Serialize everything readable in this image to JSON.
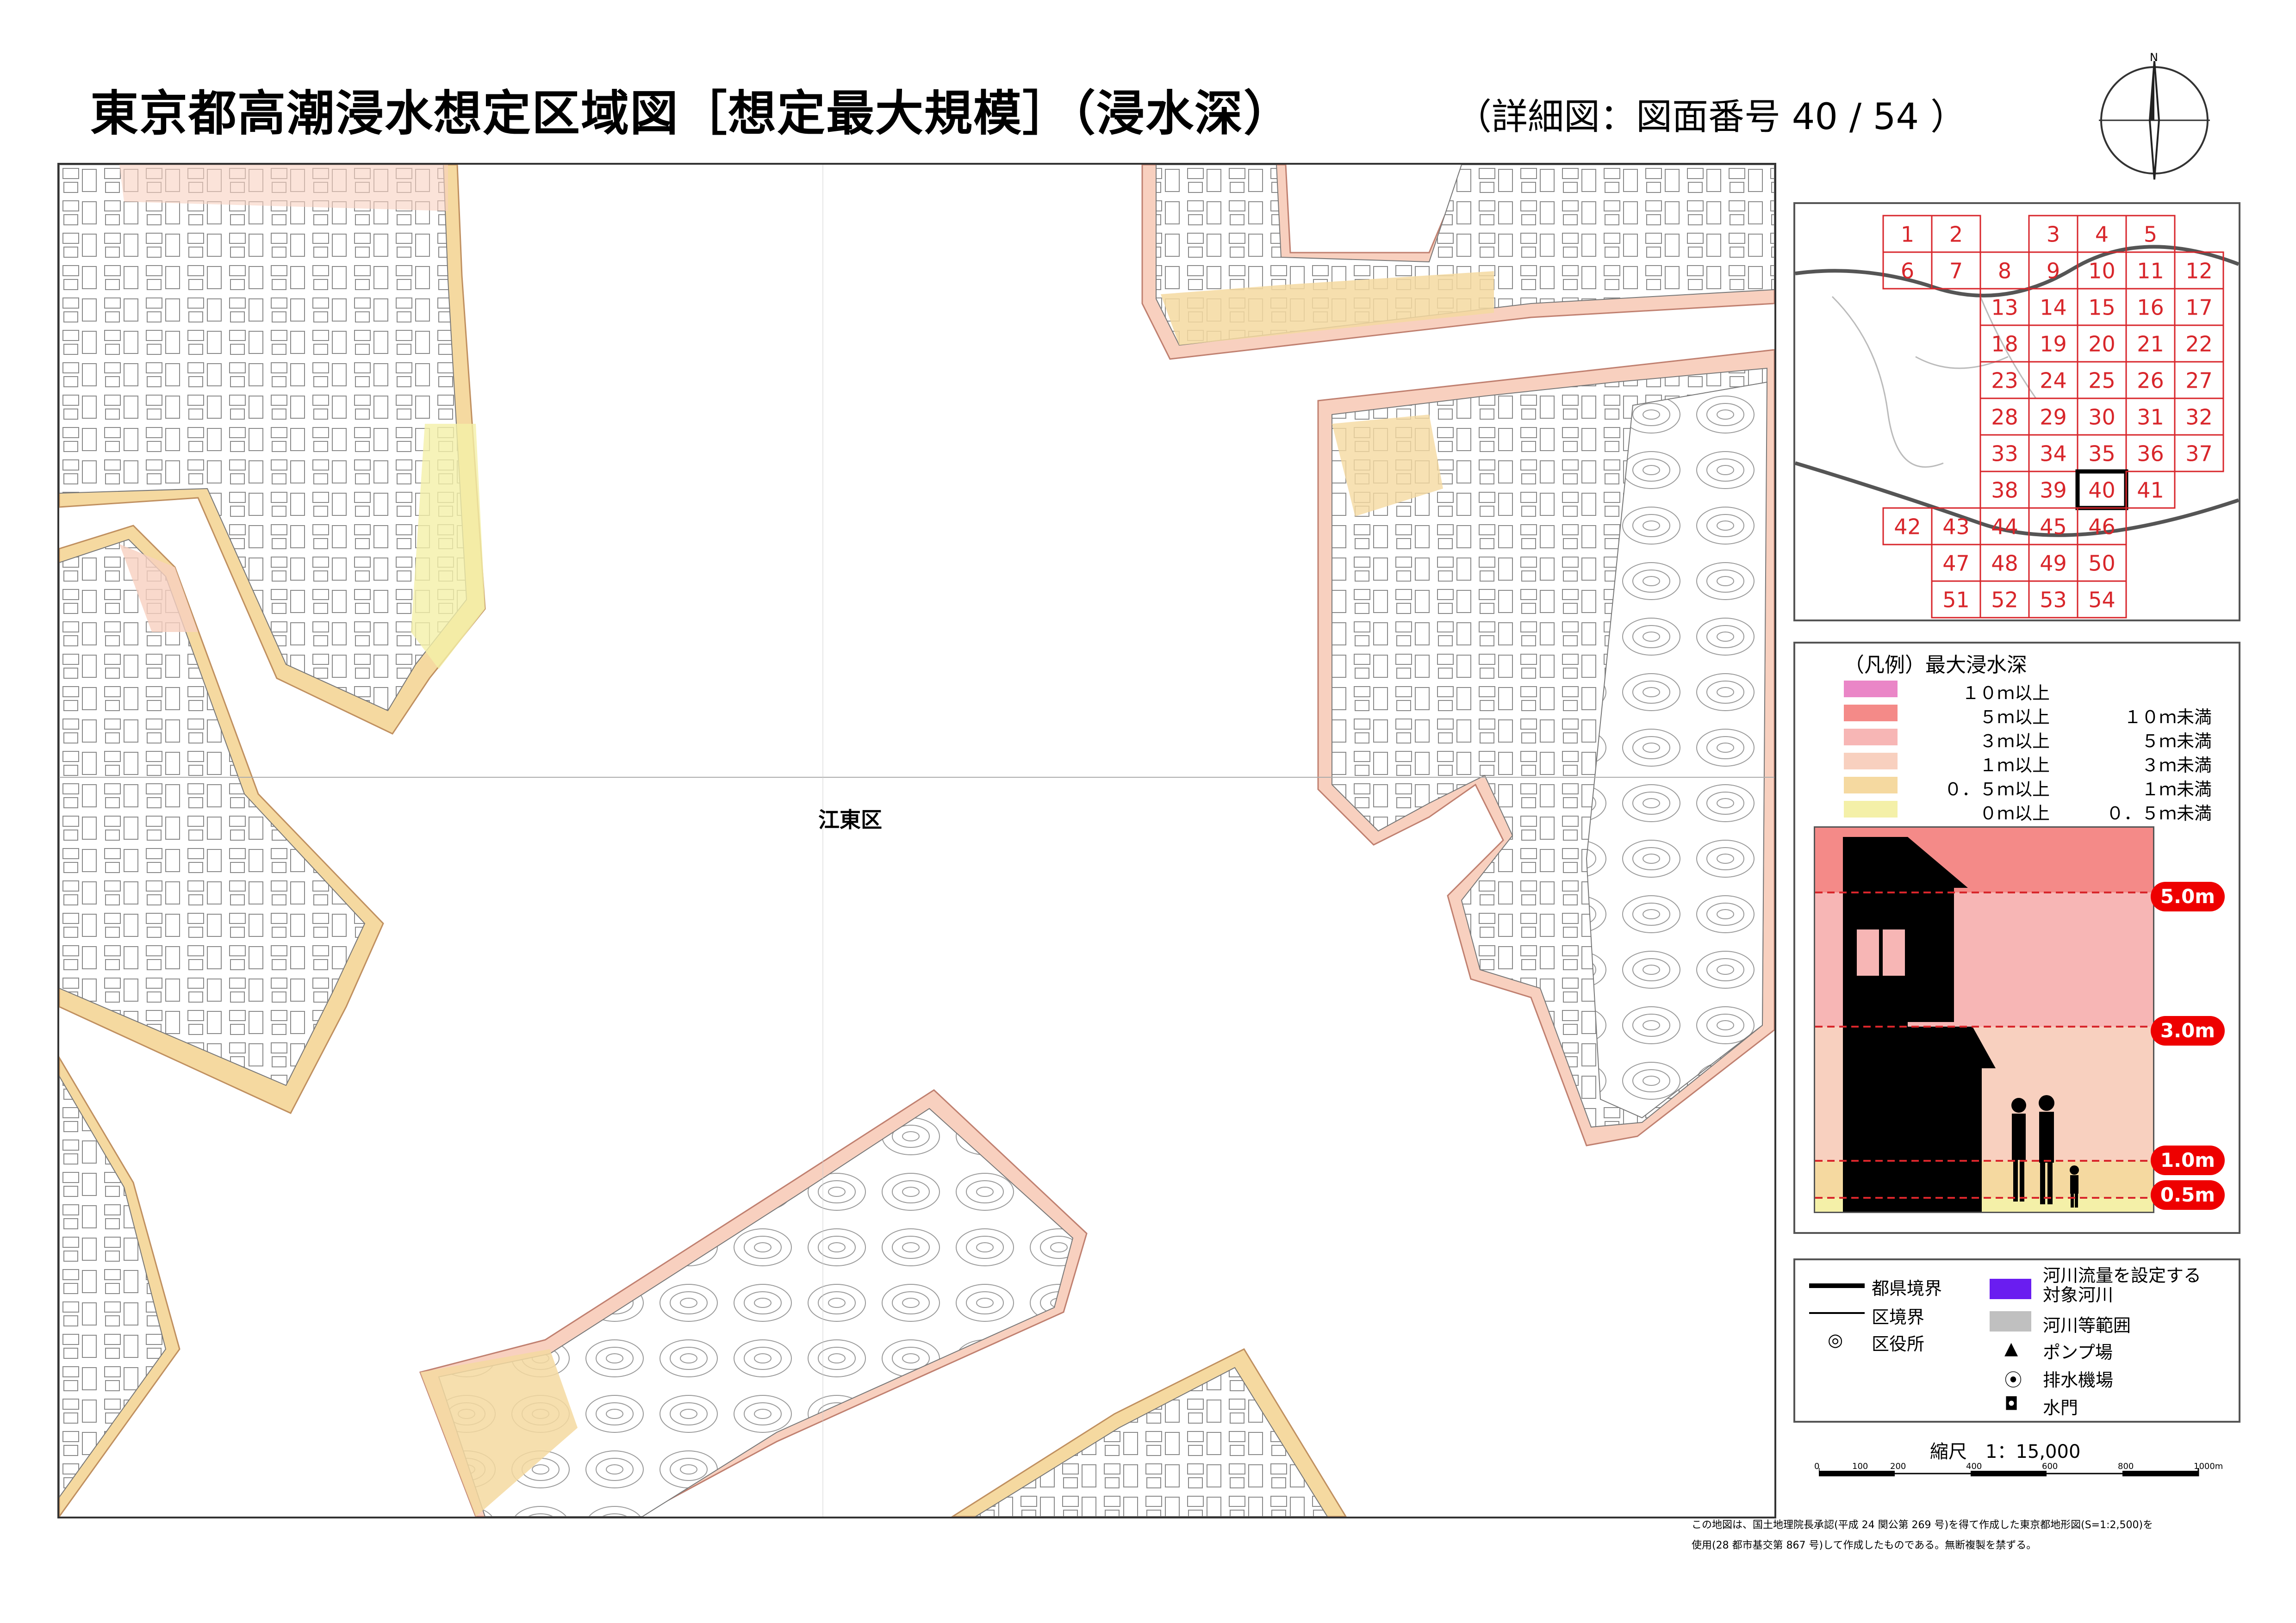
{
  "title": "東京都高潮浸水想定区域図［想定最大規模］（浸水深）",
  "subtitle": "（詳細図：図面番号 40 / 54 ）",
  "compass_label": "N",
  "map": {
    "district_label": "江東区",
    "colors": {
      "flood_0_05": "#f4f0a8",
      "flood_05_1": "#f5d9a0",
      "flood_1_3": "#f8d0bf",
      "flood_3_5": "#f7b6b5",
      "flood_5_10": "#f48a88",
      "flood_10plus": "#ea86c7",
      "land": "#ffffff",
      "linework": "#7a7a7a"
    }
  },
  "index_map": {
    "rows": [
      [
        "1",
        "2",
        "",
        "3",
        "4",
        "5",
        ""
      ],
      [
        "6",
        "7",
        "8",
        "9",
        "10",
        "11",
        "12"
      ],
      [
        "",
        "",
        "13",
        "14",
        "15",
        "16",
        "17"
      ],
      [
        "",
        "",
        "18",
        "19",
        "20",
        "21",
        "22"
      ],
      [
        "",
        "",
        "23",
        "24",
        "25",
        "26",
        "27"
      ],
      [
        "",
        "",
        "28",
        "29",
        "30",
        "31",
        "32"
      ],
      [
        "",
        "",
        "33",
        "34",
        "35",
        "36",
        "37"
      ],
      [
        "",
        "",
        "38",
        "39",
        "40",
        "41",
        ""
      ],
      [
        "42",
        "43",
        "44",
        "45",
        "46",
        "",
        ""
      ],
      [
        "",
        "47",
        "48",
        "49",
        "50",
        "",
        ""
      ],
      [
        "",
        "51",
        "52",
        "53",
        "54",
        "",
        ""
      ]
    ],
    "current_sheet": "40",
    "cell_color": "#d8262b"
  },
  "depth_legend": {
    "title": "（凡例）最大浸水深",
    "items": [
      {
        "low": "１０ｍ以上",
        "high": "",
        "color": "#ea86c7"
      },
      {
        "low": "５ｍ以上",
        "high": "１０ｍ未満",
        "color": "#f48a88"
      },
      {
        "low": "３ｍ以上",
        "high": "５ｍ未満",
        "color": "#f7b6b5"
      },
      {
        "low": "１ｍ以上",
        "high": "３ｍ未満",
        "color": "#f8d0bf"
      },
      {
        "low": "０．５ｍ以上",
        "high": "１ｍ未満",
        "color": "#f5d9a0"
      },
      {
        "low": "０ｍ以上",
        "high": "０．５ｍ未満",
        "color": "#f4f0a8"
      }
    ],
    "depth_markers": [
      "5.0m",
      "3.0m",
      "1.0m",
      "0.5m"
    ]
  },
  "symbol_legend": {
    "pref_boundary": "都県境界",
    "ward_boundary": "区境界",
    "ward_office": "区役所",
    "target_river": "河川流量を設定する対象河川",
    "target_river_line1": "河川流量を設定する",
    "target_river_line2": "対象河川",
    "river_area": "河川等範囲",
    "pump_station": "ポンプ場",
    "drainage_station": "排水機場",
    "water_gate": "水門",
    "target_river_color": "#6a1df0",
    "river_area_color": "#c0c0c0"
  },
  "scale": {
    "label": "縮尺　1：15,000",
    "ticks": [
      "0",
      "100",
      "200",
      "400",
      "600",
      "800",
      "1000m"
    ]
  },
  "footer": {
    "line1": "この地図は、国土地理院長承認(平成 24 関公第 269 号)を得て作成した東京都地形図(S=1:2,500)を",
    "line2": "使用(28 都市基交第 867 号)して作成したものである。無断複製を禁ずる。"
  }
}
